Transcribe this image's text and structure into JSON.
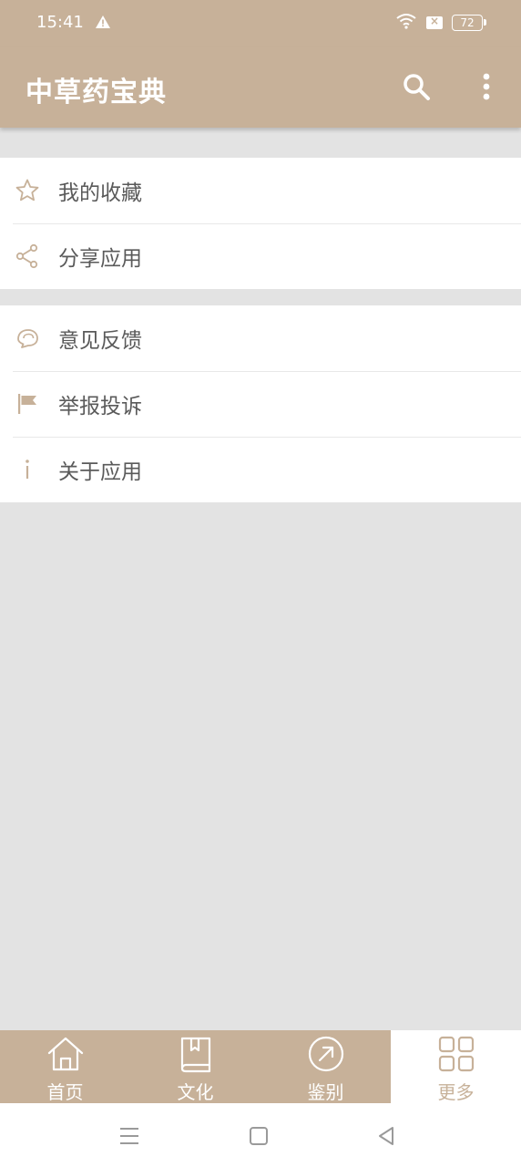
{
  "status_bar": {
    "time": "15:41",
    "battery": "72",
    "icons": [
      "warning-icon",
      "wifi-icon",
      "sim-icon",
      "battery-icon"
    ]
  },
  "app_bar": {
    "title": "中草药宝典",
    "icons": [
      "search-icon",
      "more-vert-icon"
    ]
  },
  "menu": {
    "group1": [
      {
        "label": "我的收藏",
        "icon": "star-outline-icon"
      },
      {
        "label": "分享应用",
        "icon": "share-icon"
      }
    ],
    "group2": [
      {
        "label": "意见反馈",
        "icon": "chat-bubble-icon"
      },
      {
        "label": "举报投诉",
        "icon": "flag-icon"
      },
      {
        "label": "关于应用",
        "icon": "info-icon"
      }
    ]
  },
  "bottom_nav": [
    {
      "label": "首页",
      "icon": "home-icon"
    },
    {
      "label": "文化",
      "icon": "book-icon"
    },
    {
      "label": "鉴别",
      "icon": "compass-arrow-icon"
    },
    {
      "label": "更多",
      "icon": "grid-icon",
      "active": true
    }
  ],
  "colors": {
    "primary": "#c7b199",
    "background": "#e3e3e3",
    "text": "#5a5a5a"
  }
}
